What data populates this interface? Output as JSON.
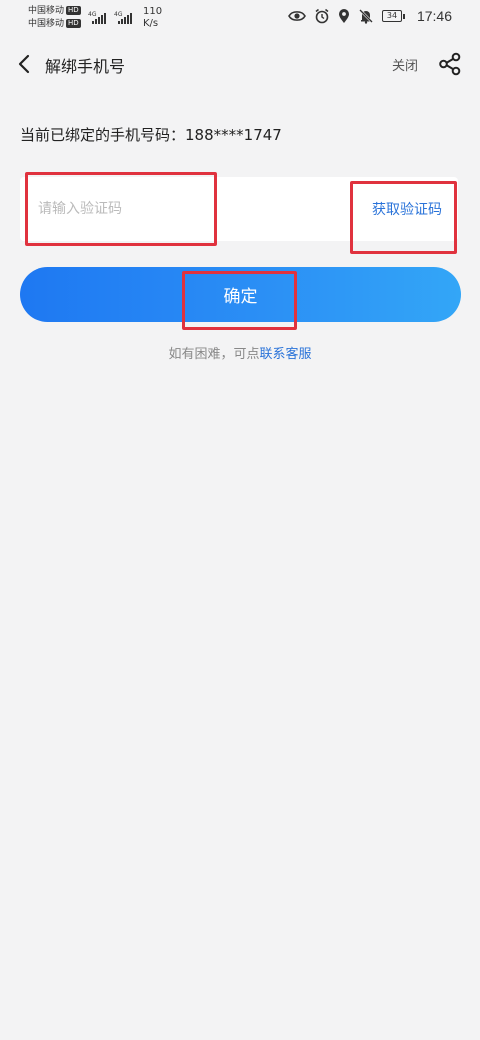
{
  "status_bar": {
    "carrier1": "中国移动",
    "carrier2": "中国移动",
    "hd": "HD",
    "net1": "4G",
    "net2": "4G",
    "speed_value": "110",
    "speed_unit": "K/s",
    "battery": "34",
    "time": "17:46",
    "icons": [
      "eye-icon",
      "alarm-icon",
      "location-icon",
      "bell-off-icon"
    ]
  },
  "header": {
    "title": "解绑手机号",
    "close_label": "关闭"
  },
  "bound_phone": {
    "label": "当前已绑定的手机号码：",
    "value": "188****1747"
  },
  "code_form": {
    "placeholder": "请输入验证码",
    "value": "",
    "get_code_label": "获取验证码"
  },
  "confirm_label": "确定",
  "help": {
    "prefix": "如有困难，可点",
    "link": "联系客服"
  },
  "colors": {
    "accent": "#2a73d9",
    "highlight": "#e0323e",
    "background": "#f3f3f4"
  }
}
